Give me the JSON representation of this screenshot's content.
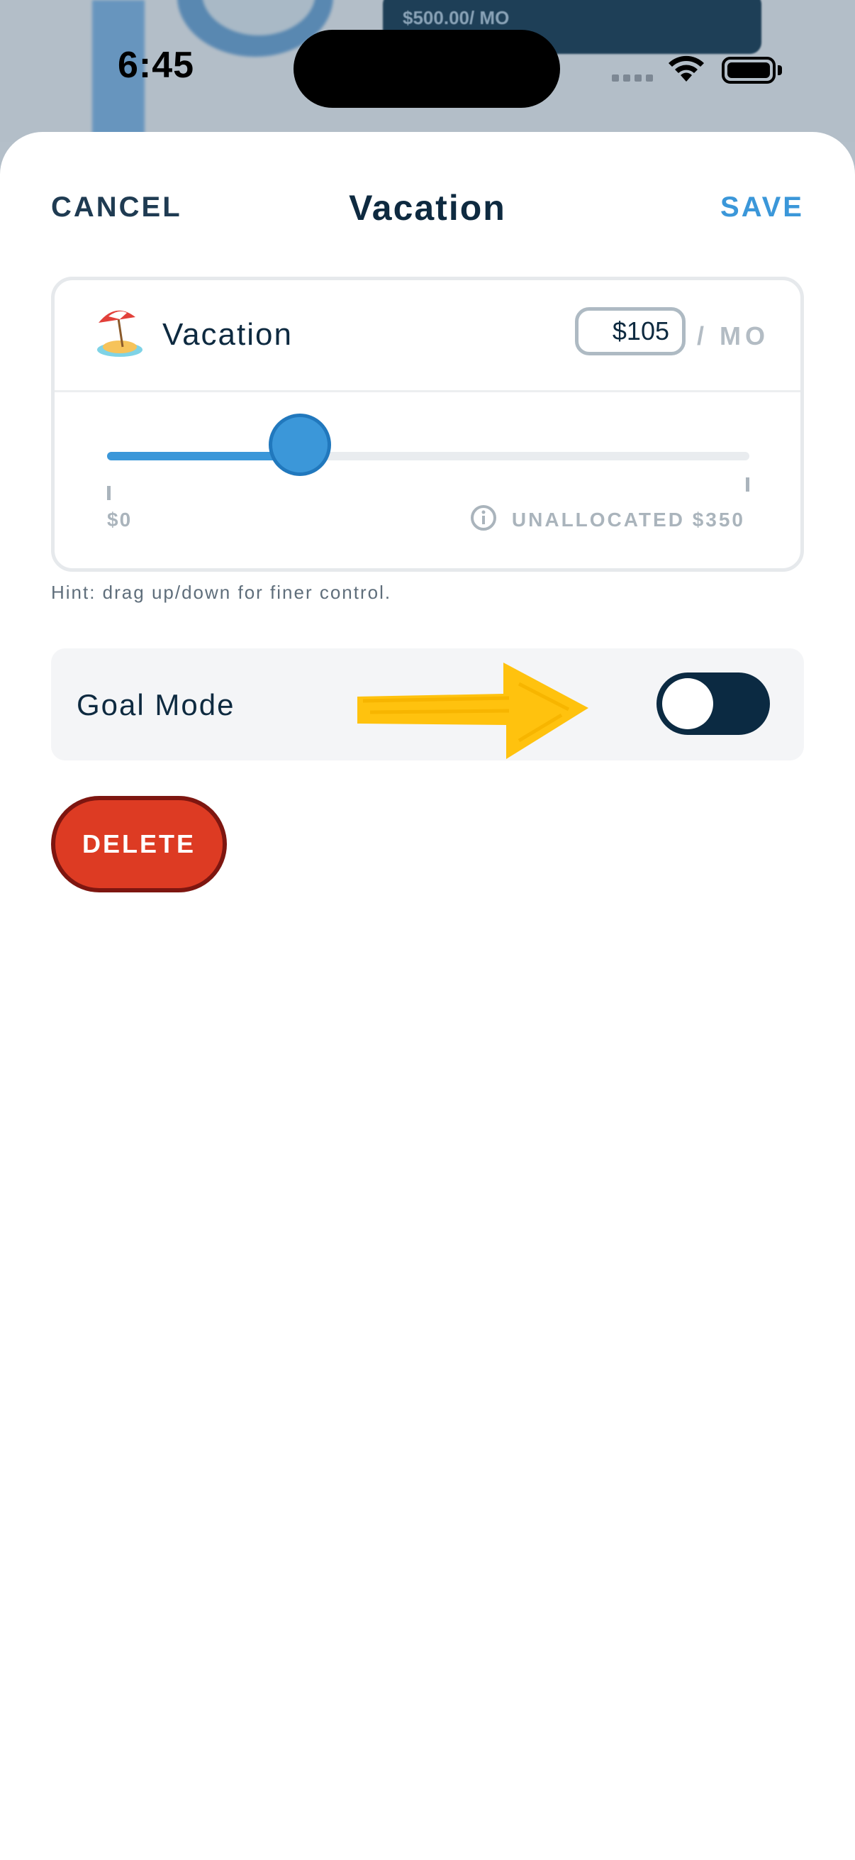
{
  "background": {
    "card_text": "$500.00/ MO"
  },
  "status_bar": {
    "time": "6:45"
  },
  "nav": {
    "cancel_label": "CANCEL",
    "title": "Vacation",
    "save_label": "SAVE"
  },
  "category": {
    "icon": "beach-umbrella-icon",
    "name": "Vacation",
    "amount": "$105",
    "per_unit": "/ MO"
  },
  "slider": {
    "value_fraction": 0.3,
    "min_label": "$0",
    "unallocated_label": "UNALLOCATED $350"
  },
  "hint": "Hint: drag up/down for finer control.",
  "goal_mode": {
    "label": "Goal Mode",
    "enabled": false
  },
  "delete_label": "DELETE",
  "colors": {
    "accent": "#3b97d9",
    "navy": "#0e2a40",
    "toggle_track": "#0b2a42",
    "delete": "#dd3b23",
    "arrow": "#ffc20e"
  }
}
